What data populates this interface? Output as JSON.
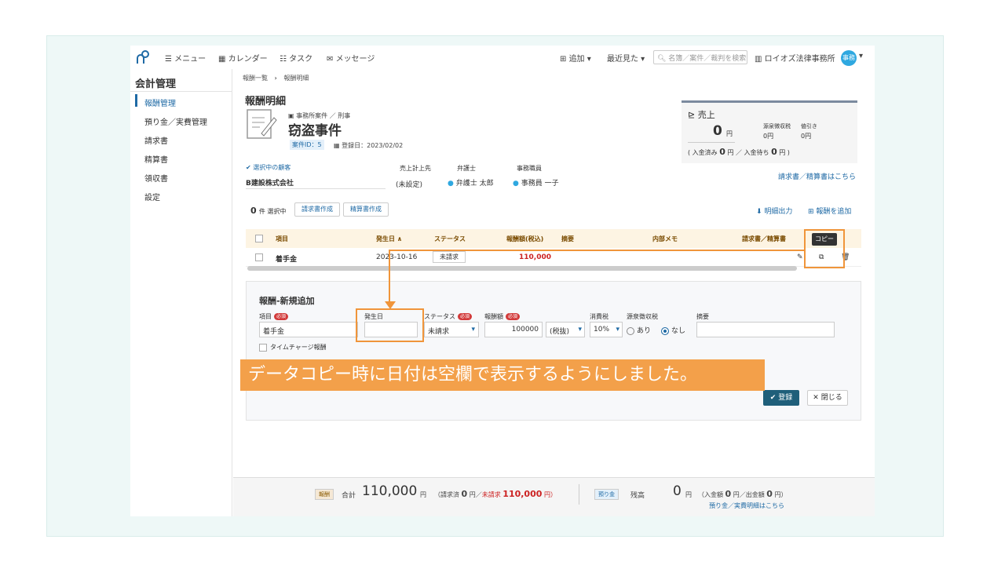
{
  "header": {
    "menu": "メニュー",
    "calendar": "カレンダー",
    "task": "タスク",
    "message": "メッセージ",
    "add": "追加",
    "recent": "最近見た",
    "search_placeholder": "名簿／案件／裁判を検索",
    "office": "ロイオズ法律事務所",
    "avatar": "事務"
  },
  "sidebar": {
    "title": "会計管理",
    "items": [
      {
        "label": "報酬管理"
      },
      {
        "label": "預り金／実費管理"
      },
      {
        "label": "請求書"
      },
      {
        "label": "精算書"
      },
      {
        "label": "領収書"
      },
      {
        "label": "設定"
      }
    ]
  },
  "breadcrumb": {
    "parent": "報酬一覧",
    "sep": "›",
    "current": "報酬明細"
  },
  "page": {
    "title": "報酬明細",
    "case_type": "事務所案件 ／ 刑事",
    "case_name": "窃盗事件",
    "case_id": "案件ID：5",
    "registered": "登録日：2023/02/02",
    "client_label": "選択中の顧客",
    "client_name": "B建設株式会社",
    "sales_dest_label": "売上計上先",
    "sales_dest_value": "(未設定)",
    "lawyer_label": "弁護士",
    "lawyer_value": "弁護士 太郎",
    "staff_label": "事務職員",
    "staff_value": "事務員 一子"
  },
  "sales": {
    "title": "売上",
    "amount": "0",
    "yen": "円",
    "withholding_label": "源泉徴収税",
    "withholding_value": "0円",
    "discount_label": "値引き",
    "discount_value": "0円",
    "paid_line_a": "( 入金済み",
    "paid_value": "0",
    "paid_line_b": "円 ／ 入金待ち",
    "pending_value": "0",
    "paid_line_c": "円 )",
    "link": "請求書／精算書はこちら"
  },
  "toolbar": {
    "selected_count": "0",
    "selected_label": "件 選択中",
    "invoice_btn": "請求書作成",
    "settle_btn": "精算書作成",
    "export": "明細出力",
    "add_fee": "報酬を追加"
  },
  "table": {
    "headers": [
      "項目",
      "発生日 ∧",
      "ステータス",
      "報酬額(税込)",
      "摘要",
      "内部メモ",
      "請求書／精算書"
    ],
    "rows": [
      {
        "item": "着手金",
        "date": "2023-10-16",
        "status": "未請求",
        "amount": "110,000"
      }
    ],
    "tooltip": "コピー"
  },
  "form": {
    "title": "報酬-新規追加",
    "required": "必須",
    "item_label": "項目",
    "item_value": "着手金",
    "date_label": "発生日",
    "date_value": "",
    "status_label": "ステータス",
    "status_value": "未請求",
    "amount_label": "報酬額",
    "amount_value": "100000",
    "tax_mode": "(税抜)",
    "tax_label": "消費税",
    "tax_value": "10%",
    "withholding_label": "源泉徴収税",
    "withholding_yes": "あり",
    "withholding_no": "なし",
    "memo_label": "摘要",
    "timecharge": "タイムチャージ報酬",
    "save": "登録",
    "close": "閉じる"
  },
  "footer": {
    "fee_badge": "報酬",
    "total_label": "合計",
    "total": "110,000",
    "yen": "円",
    "billed_a": "（請求済",
    "billed": "0",
    "billed_b": "円／",
    "unbilled_label": "未請求",
    "unbilled": "110,000",
    "unbilled_b": "円）",
    "deposit_badge": "預り金",
    "balance_label": "残高",
    "balance": "0",
    "in_a": "（入金額",
    "in": "0",
    "in_b": "円／出金額",
    "out": "0",
    "out_b": "円）",
    "link": "預り金／実費明細はこちら"
  },
  "annotation": {
    "banner": "データコピー時に日付は空欄で表示するようにしました。"
  },
  "colors": {
    "accent": "#1f6aa5",
    "highlight": "#f0953a",
    "danger": "#d23a3a"
  }
}
